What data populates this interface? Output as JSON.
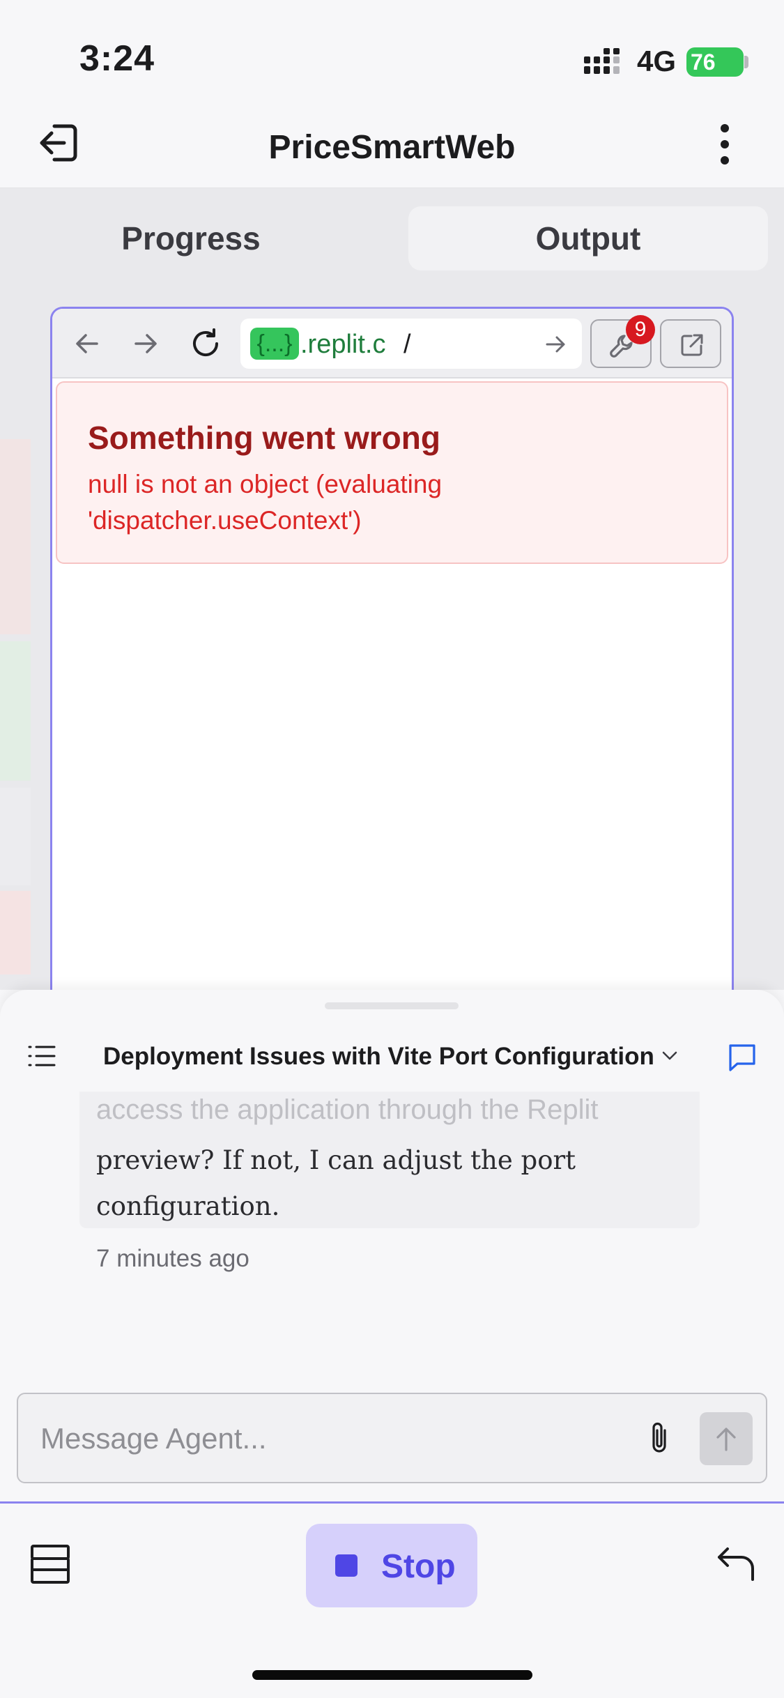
{
  "status_bar": {
    "time": "3:24",
    "network": "4G",
    "battery": "76"
  },
  "header": {
    "title": "PriceSmartWeb"
  },
  "tabs": {
    "progress": "Progress",
    "output": "Output"
  },
  "browser": {
    "url_badge": "{...}",
    "url_host": ".replit.c",
    "url_path": "/",
    "devtools_count": "9"
  },
  "error": {
    "title": "Something went wrong",
    "message": "null is not an object (evaluating 'dispatcher.useContext')"
  },
  "thread": {
    "title": "Deployment Issues with Vite Port Configuration",
    "message_faded": "access the application through the Replit",
    "message": "preview? If not, I can adjust the port configuration.",
    "timestamp": "7 minutes ago"
  },
  "composer": {
    "placeholder": "Message Agent..."
  },
  "actions": {
    "stop_label": "Stop"
  },
  "colors": {
    "accent": "#4f46e5",
    "preview_border": "#8b83ef",
    "error_text": "#dc2626",
    "error_title": "#991b1b",
    "battery": "#34c759"
  }
}
